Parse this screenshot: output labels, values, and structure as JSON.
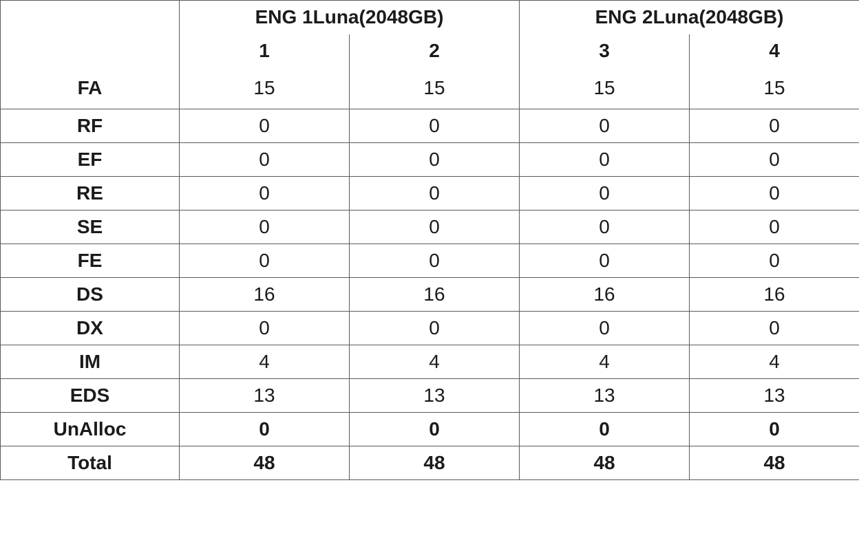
{
  "groups": [
    {
      "label": "ENG 1Luna(2048GB)",
      "sub": [
        "1",
        "2"
      ]
    },
    {
      "label": "ENG 2Luna(2048GB)",
      "sub": [
        "3",
        "4"
      ]
    }
  ],
  "rows": [
    {
      "label": "FA",
      "values": [
        "15",
        "15",
        "15",
        "15"
      ],
      "bold": false
    },
    {
      "label": "RF",
      "values": [
        "0",
        "0",
        "0",
        "0"
      ],
      "bold": false
    },
    {
      "label": "EF",
      "values": [
        "0",
        "0",
        "0",
        "0"
      ],
      "bold": false
    },
    {
      "label": "RE",
      "values": [
        "0",
        "0",
        "0",
        "0"
      ],
      "bold": false
    },
    {
      "label": "SE",
      "values": [
        "0",
        "0",
        "0",
        "0"
      ],
      "bold": false
    },
    {
      "label": "FE",
      "values": [
        "0",
        "0",
        "0",
        "0"
      ],
      "bold": false
    },
    {
      "label": "DS",
      "values": [
        "16",
        "16",
        "16",
        "16"
      ],
      "bold": false
    },
    {
      "label": "DX",
      "values": [
        "0",
        "0",
        "0",
        "0"
      ],
      "bold": false
    },
    {
      "label": "IM",
      "values": [
        "4",
        "4",
        "4",
        "4"
      ],
      "bold": false
    },
    {
      "label": "EDS",
      "values": [
        "13",
        "13",
        "13",
        "13"
      ],
      "bold": false
    },
    {
      "label": "UnAlloc",
      "values": [
        "0",
        "0",
        "0",
        "0"
      ],
      "bold": true
    },
    {
      "label": "Total",
      "values": [
        "48",
        "48",
        "48",
        "48"
      ],
      "bold": true
    }
  ],
  "chart_data": {
    "type": "table",
    "column_groups": [
      "ENG 1Luna(2048GB)",
      "ENG 1Luna(2048GB)",
      "ENG 2Luna(2048GB)",
      "ENG 2Luna(2048GB)"
    ],
    "columns": [
      "1",
      "2",
      "3",
      "4"
    ],
    "row_labels": [
      "FA",
      "RF",
      "EF",
      "RE",
      "SE",
      "FE",
      "DS",
      "DX",
      "IM",
      "EDS",
      "UnAlloc",
      "Total"
    ],
    "values": [
      [
        15,
        15,
        15,
        15
      ],
      [
        0,
        0,
        0,
        0
      ],
      [
        0,
        0,
        0,
        0
      ],
      [
        0,
        0,
        0,
        0
      ],
      [
        0,
        0,
        0,
        0
      ],
      [
        0,
        0,
        0,
        0
      ],
      [
        16,
        16,
        16,
        16
      ],
      [
        0,
        0,
        0,
        0
      ],
      [
        4,
        4,
        4,
        4
      ],
      [
        13,
        13,
        13,
        13
      ],
      [
        0,
        0,
        0,
        0
      ],
      [
        48,
        48,
        48,
        48
      ]
    ]
  }
}
